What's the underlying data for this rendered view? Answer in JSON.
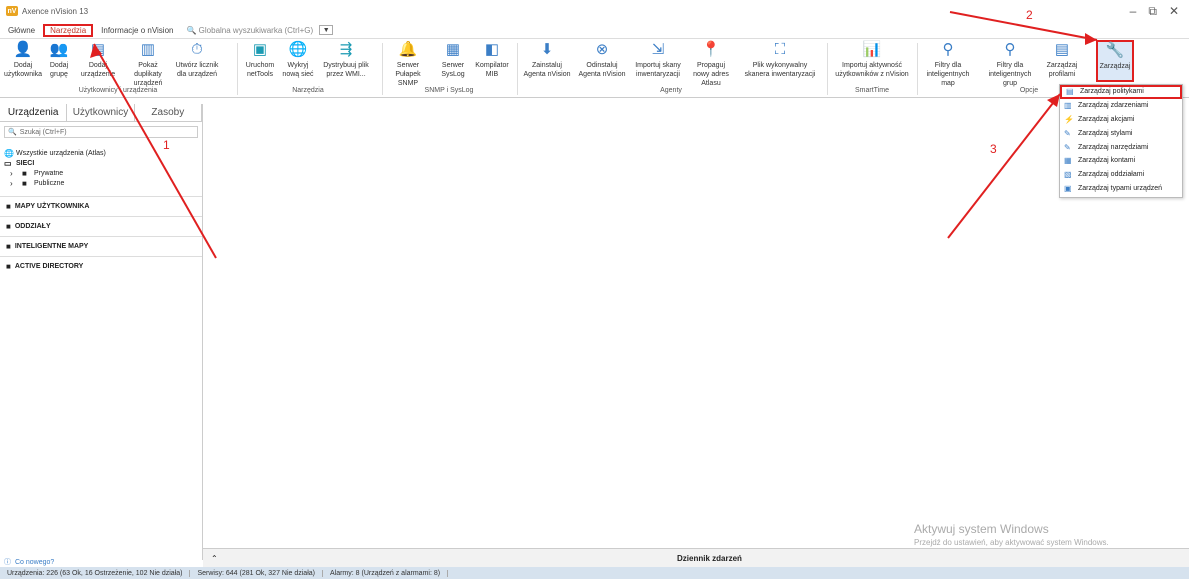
{
  "window": {
    "title": "Axence nVision 13",
    "logo": "nV"
  },
  "menu": {
    "tabs": [
      "Główne",
      "Narzędzia",
      "Informacje o nVision"
    ],
    "search_label": "Globalna wyszukiwarka (Ctrl+G)"
  },
  "ribbon": {
    "buttons": [
      {
        "label": "Dodaj użytkownika",
        "icon": "add-user-icon"
      },
      {
        "label": "Dodaj grupę",
        "icon": "add-group-icon"
      },
      {
        "label": "Dodaj urządzenie",
        "icon": "add-device-icon"
      },
      {
        "label": "Pokaż duplikaty urządzeń",
        "icon": "duplicates-icon"
      },
      {
        "label": "Utwórz licznik dla urządzeń",
        "icon": "counter-icon"
      },
      {
        "label": "Uruchom netTools",
        "icon": "nettools-icon"
      },
      {
        "label": "Wykryj nową sieć",
        "icon": "network-icon"
      },
      {
        "label": "Dystrybuuj plik przez WMI...",
        "icon": "distribute-icon"
      },
      {
        "label": "Serwer Pułapek SNMP",
        "icon": "trap-icon"
      },
      {
        "label": "Serwer SysLog",
        "icon": "syslog-icon"
      },
      {
        "label": "Kompilator MIB",
        "icon": "mib-icon"
      },
      {
        "label": "Zainstaluj Agenta nVision",
        "icon": "install-agent-icon"
      },
      {
        "label": "Odinstaluj Agenta nVision",
        "icon": "uninstall-agent-icon"
      },
      {
        "label": "Importuj skany inwentaryzacji",
        "icon": "import-icon"
      },
      {
        "label": "Propaguj nowy adres Atlasu",
        "icon": "propagate-icon"
      },
      {
        "label": "Plik wykonywalny skanera inwentaryzacji",
        "icon": "scanner-icon"
      },
      {
        "label": "Importuj aktywność użytkowników z nVision",
        "icon": "activity-icon"
      },
      {
        "label": "Filtry dla inteligentnych map",
        "icon": "filter-icon"
      },
      {
        "label": "Filtry dla inteligentnych grup",
        "icon": "filter-group-icon"
      },
      {
        "label": "Zarządzaj profilami",
        "icon": "profiles-icon"
      },
      {
        "label": "Zarządzaj",
        "icon": "wrench-icon"
      }
    ],
    "groups": [
      "Użytkownicy i urządzenia",
      "Narzędzia",
      "SNMP i SysLog",
      "Agenty",
      "SmartTime",
      "Opcje"
    ]
  },
  "left_panel": {
    "tabs": [
      "Urządzenia",
      "Użytkownicy",
      "Zasoby"
    ],
    "search_placeholder": "Szukaj (Ctrl+F)",
    "atlas": "Wszystkie urządzenia (Atlas)",
    "sieci": "SIECI",
    "tree": [
      "Prywatne",
      "Publiczne"
    ],
    "sections": [
      "MAPY UŻYTKOWNIKA",
      "ODDZIAŁY",
      "INTELIGENTNE MAPY",
      "ACTIVE DIRECTORY"
    ],
    "whats_new": "Co nowego?"
  },
  "dropdown": {
    "items": [
      "Zarządzaj politykami",
      "Zarządzaj zdarzeniami",
      "Zarządzaj akcjami",
      "Zarządzaj stylami",
      "Zarządzaj narzędziami",
      "Zarządzaj kontami",
      "Zarządzaj oddziałami",
      "Zarządzaj typami urządzeń"
    ]
  },
  "event_log": {
    "label": "Dziennik zdarzeń"
  },
  "status": {
    "devices": "Urządzenia: 226 (63 Ok, 16 Ostrzeżenie, 102 Nie działa)",
    "services": "Serwisy: 644 (281 Ok, 327 Nie działa)",
    "alarms": "Alarmy: 8 (Urządzeń z alarmami: 8)"
  },
  "watermark": {
    "title": "Aktywuj system Windows",
    "subtitle": "Przejdź do ustawień, aby aktywować system Windows."
  },
  "annotations": [
    "1",
    "2",
    "3"
  ]
}
